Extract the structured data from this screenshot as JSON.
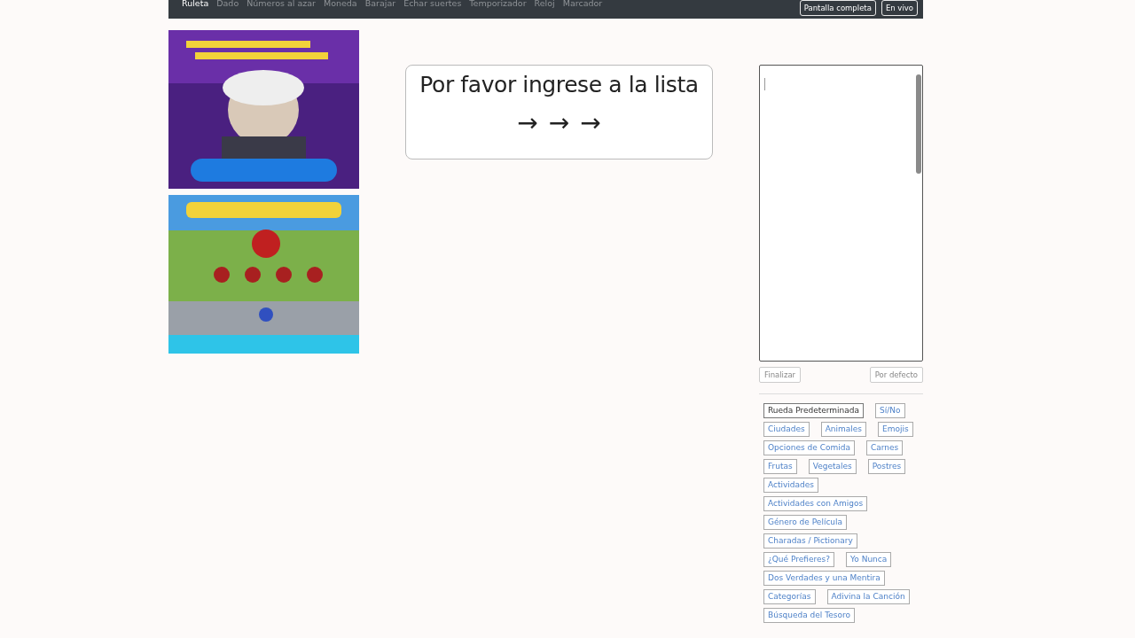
{
  "navbar": {
    "links": [
      {
        "label": "Ruleta",
        "selected": true
      },
      {
        "label": "Dado",
        "selected": false
      },
      {
        "label": "Números al azar",
        "selected": false
      },
      {
        "label": "Moneda",
        "selected": false
      },
      {
        "label": "Barajar",
        "selected": false
      },
      {
        "label": "Echar suertes",
        "selected": false
      },
      {
        "label": "Temporizador",
        "selected": false
      },
      {
        "label": "Reloj",
        "selected": false
      },
      {
        "label": "Marcador",
        "selected": false
      }
    ],
    "buttons": [
      "Pantalla completa",
      "En vivo"
    ]
  },
  "wheel_card": {
    "message": "Por favor ingrese a la lista",
    "arrows": [
      "→",
      "→",
      "→"
    ]
  },
  "list_editor": {
    "buttons": [
      "Finalizar",
      "Por defecto"
    ]
  },
  "presets": [
    {
      "label": "Rueda Predeterminada",
      "selected": true
    },
    {
      "label": "Sí/No",
      "selected": false
    },
    {
      "label": "Ciudades",
      "selected": false
    },
    {
      "label": "Animales",
      "selected": false
    },
    {
      "label": "Emojis",
      "selected": false
    },
    {
      "label": "Opciones de Comida",
      "selected": false
    },
    {
      "label": "Carnes",
      "selected": false
    },
    {
      "label": "Frutas",
      "selected": false
    },
    {
      "label": "Vegetales",
      "selected": false
    },
    {
      "label": "Postres",
      "selected": false
    },
    {
      "label": "Actividades",
      "selected": false
    },
    {
      "label": "Actividades con Amigos",
      "selected": false
    },
    {
      "label": "Género de Película",
      "selected": false
    },
    {
      "label": "Charadas / Pictionary",
      "selected": false
    },
    {
      "label": "¿Qué Prefieres?",
      "selected": false
    },
    {
      "label": "Yo Nunca",
      "selected": false
    },
    {
      "label": "Dos Verdades y una Mentira",
      "selected": false
    },
    {
      "label": "Categorías",
      "selected": false
    },
    {
      "label": "Adivina la Canción",
      "selected": false
    },
    {
      "label": "Búsqueda del Tesoro",
      "selected": false
    }
  ]
}
